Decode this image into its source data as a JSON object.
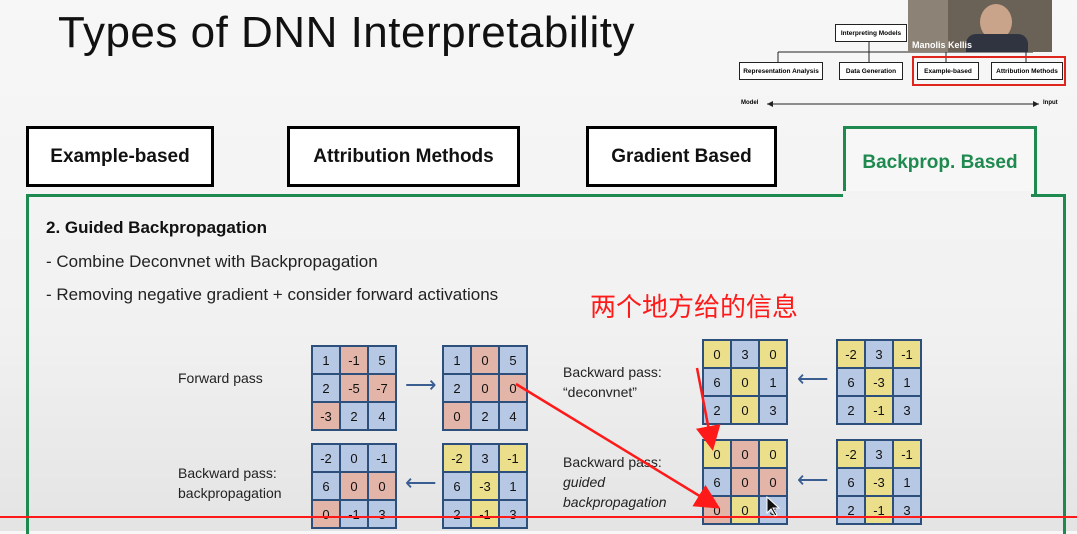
{
  "slide": {
    "title": "Types of DNN Interpretability",
    "tabs": [
      {
        "label": "Example-based",
        "active": false
      },
      {
        "label": "Attribution Methods",
        "active": false
      },
      {
        "label": "Gradient Based",
        "active": false
      },
      {
        "label": "Backprop. Based",
        "active": true
      }
    ],
    "section_heading": "2. Guided Backpropagation",
    "bullets": [
      "- Combine Deconvnet with Backpropagation",
      "- Removing negative gradient + consider forward activations"
    ],
    "annotation_cn": "两个地方给的信息",
    "labels": {
      "forward": "Forward pass",
      "backward_deconv_1": "Backward pass:",
      "backward_deconv_2": "“deconvnet”",
      "backward_bp_1": "Backward pass:",
      "backward_bp_2": "backpropagation",
      "backward_guided_1": "Backward pass:",
      "backward_guided_2": "guided",
      "backward_guided_3": "backpropagation"
    },
    "grids": {
      "forward_in": [
        [
          "1",
          "-1",
          "5"
        ],
        [
          "2",
          "-5",
          "-7"
        ],
        [
          "-3",
          "2",
          "4"
        ]
      ],
      "forward_out": [
        [
          "1",
          "0",
          "5"
        ],
        [
          "2",
          "0",
          "0"
        ],
        [
          "0",
          "2",
          "4"
        ]
      ],
      "bp_in": [
        [
          "-2",
          "0",
          "-1"
        ],
        [
          "6",
          "0",
          "0"
        ],
        [
          "0",
          "-1",
          "3"
        ]
      ],
      "bp_out": [
        [
          "-2",
          "3",
          "-1"
        ],
        [
          "6",
          "-3",
          "1"
        ],
        [
          "2",
          "-1",
          "3"
        ]
      ],
      "deconv_out": [
        [
          "0",
          "3",
          "0"
        ],
        [
          "6",
          "0",
          "1"
        ],
        [
          "2",
          "0",
          "3"
        ]
      ],
      "deconv_in": [
        [
          "-2",
          "3",
          "-1"
        ],
        [
          "6",
          "-3",
          "1"
        ],
        [
          "2",
          "-1",
          "3"
        ]
      ],
      "guided_out": [
        [
          "0",
          "0",
          "0"
        ],
        [
          "6",
          "0",
          "0"
        ],
        [
          "0",
          "0",
          "3"
        ]
      ],
      "guided_in": [
        [
          "-2",
          "3",
          "-1"
        ],
        [
          "6",
          "-3",
          "1"
        ],
        [
          "2",
          "-1",
          "3"
        ]
      ]
    },
    "grid_colors": {
      "forward_in": [
        [
          "b",
          "r",
          "b"
        ],
        [
          "b",
          "r",
          "r"
        ],
        [
          "r",
          "b",
          "b"
        ]
      ],
      "forward_out": [
        [
          "b",
          "r",
          "b"
        ],
        [
          "b",
          "r",
          "r"
        ],
        [
          "r",
          "b",
          "b"
        ]
      ],
      "bp_in": [
        [
          "b",
          "b",
          "b"
        ],
        [
          "b",
          "r",
          "r"
        ],
        [
          "r",
          "b",
          "b"
        ]
      ],
      "bp_out": [
        [
          "y",
          "b",
          "y"
        ],
        [
          "b",
          "y",
          "b"
        ],
        [
          "b",
          "y",
          "b"
        ]
      ],
      "deconv_out": [
        [
          "y",
          "b",
          "y"
        ],
        [
          "b",
          "y",
          "b"
        ],
        [
          "b",
          "y",
          "b"
        ]
      ],
      "deconv_in": [
        [
          "y",
          "b",
          "y"
        ],
        [
          "b",
          "y",
          "b"
        ],
        [
          "b",
          "y",
          "b"
        ]
      ],
      "guided_out": [
        [
          "y",
          "r",
          "y"
        ],
        [
          "b",
          "r",
          "r"
        ],
        [
          "r",
          "y",
          "b"
        ]
      ],
      "guided_in": [
        [
          "y",
          "b",
          "y"
        ],
        [
          "b",
          "y",
          "b"
        ],
        [
          "b",
          "y",
          "b"
        ]
      ]
    }
  },
  "diagram": {
    "root": "Interpreting Models",
    "leaves": [
      "Representation Analysis",
      "Data Generation",
      "Example-based",
      "Attribution Methods"
    ],
    "axis_left": "Model",
    "axis_right": "Input"
  },
  "webcam": {
    "name": "Manolis Kellis"
  },
  "colors": {
    "accent": "#1e8a4f",
    "annotation": "#ff1a1a",
    "grid_border": "#2d4f7c"
  }
}
